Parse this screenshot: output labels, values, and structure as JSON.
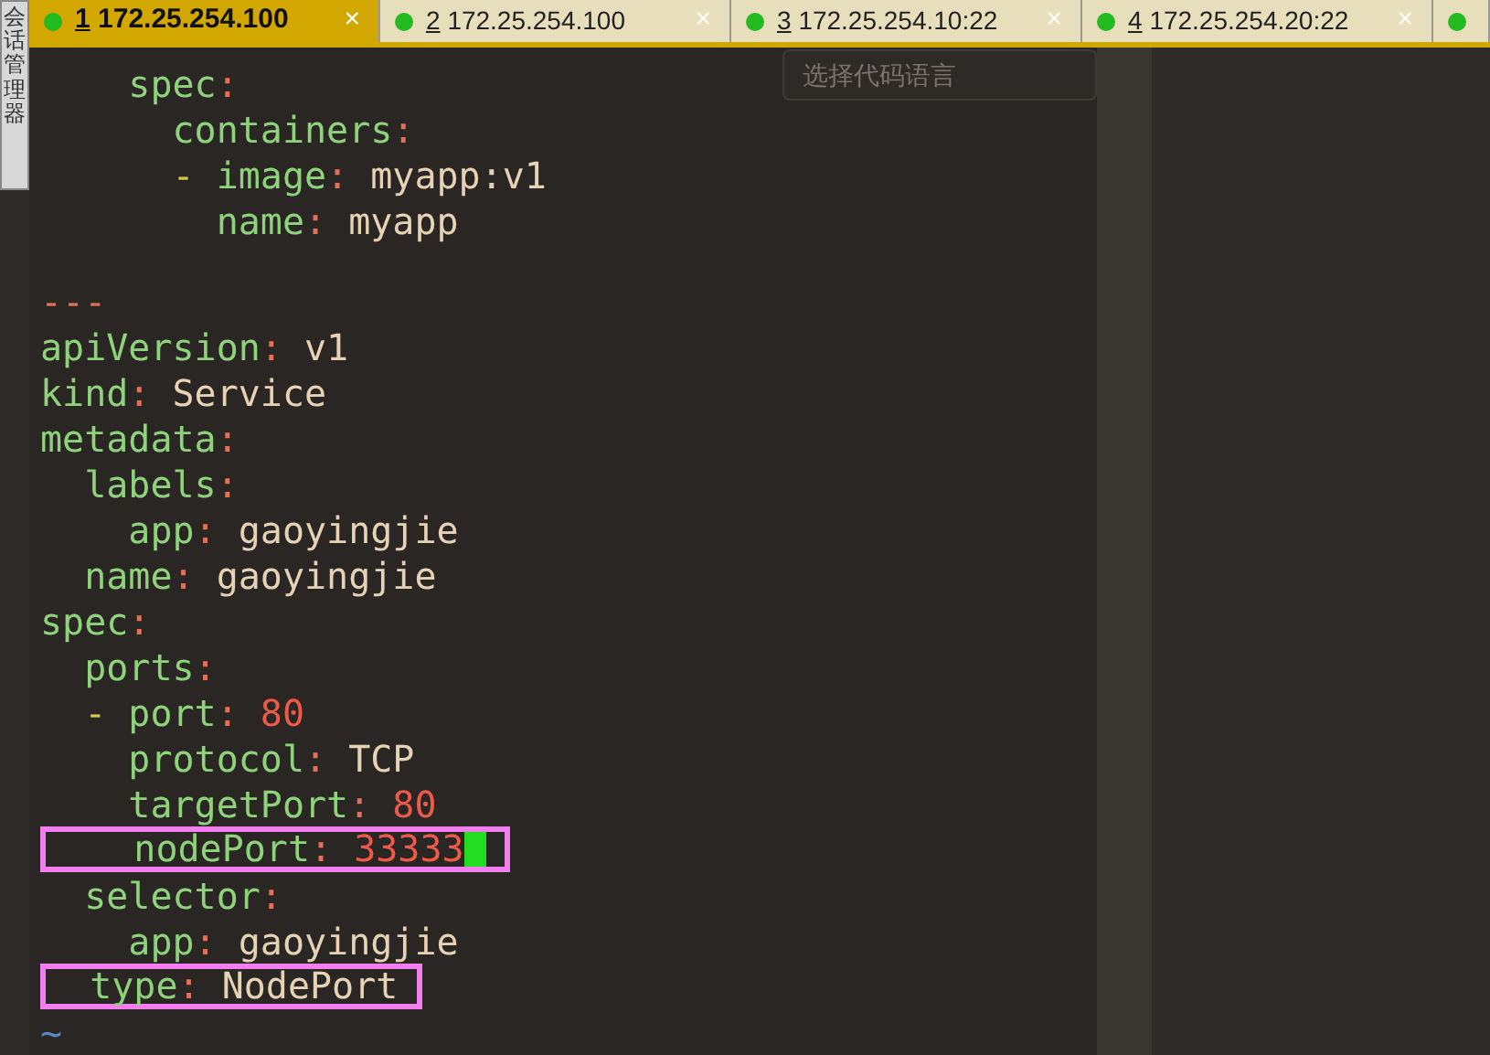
{
  "sidebar": {
    "label": "会话管理器"
  },
  "tabs": [
    {
      "number": "1",
      "title": "172.25.254.100",
      "close": "×",
      "selected": true,
      "color": "#22bb22"
    },
    {
      "number": "2",
      "title": "172.25.254.100",
      "close": "×",
      "selected": false,
      "color": "#22bb22"
    },
    {
      "number": "3",
      "title": "172.25.254.10:22",
      "close": "×",
      "selected": false,
      "color": "#22bb22"
    },
    {
      "number": "4",
      "title": "172.25.254.20:22",
      "close": "×",
      "selected": false,
      "color": "#22bb22"
    },
    {
      "selected": false,
      "color": "#22bb22"
    }
  ],
  "language_selector": {
    "placeholder": "选择代码语言"
  },
  "editor": {
    "lines": [
      {
        "kind": "code",
        "tokens": [
          {
            "t": "    spec",
            "kind": "key"
          },
          {
            "t": ":",
            "kind": "punct"
          }
        ]
      },
      {
        "kind": "code",
        "tokens": [
          {
            "t": "      containers",
            "kind": "key"
          },
          {
            "t": ":",
            "kind": "punct"
          }
        ]
      },
      {
        "kind": "code",
        "tokens": [
          {
            "t": "      -",
            "kind": "dash"
          },
          {
            "t": " image",
            "kind": "key"
          },
          {
            "t": ":",
            "kind": "punct"
          },
          {
            "t": " myapp:v1",
            "kind": "value"
          }
        ]
      },
      {
        "kind": "code",
        "tokens": [
          {
            "t": "        name",
            "kind": "key"
          },
          {
            "t": ":",
            "kind": "punct"
          },
          {
            "t": " myapp",
            "kind": "value"
          }
        ]
      },
      {
        "kind": "blank"
      },
      {
        "kind": "code",
        "tokens": [
          {
            "t": "---",
            "kind": "separator"
          }
        ]
      },
      {
        "kind": "code",
        "tokens": [
          {
            "t": "apiVersion",
            "kind": "key"
          },
          {
            "t": ":",
            "kind": "punct"
          },
          {
            "t": " v1",
            "kind": "value"
          }
        ]
      },
      {
        "kind": "code",
        "tokens": [
          {
            "t": "kind",
            "kind": "key"
          },
          {
            "t": ":",
            "kind": "punct"
          },
          {
            "t": " Service",
            "kind": "value"
          }
        ]
      },
      {
        "kind": "code",
        "tokens": [
          {
            "t": "metadata",
            "kind": "key"
          },
          {
            "t": ":",
            "kind": "punct"
          }
        ]
      },
      {
        "kind": "code",
        "tokens": [
          {
            "t": "  labels",
            "kind": "key"
          },
          {
            "t": ":",
            "kind": "punct"
          }
        ]
      },
      {
        "kind": "code",
        "tokens": [
          {
            "t": "    app",
            "kind": "key"
          },
          {
            "t": ":",
            "kind": "punct"
          },
          {
            "t": " gaoyingjie",
            "kind": "value"
          }
        ]
      },
      {
        "kind": "code",
        "tokens": [
          {
            "t": "  name",
            "kind": "key"
          },
          {
            "t": ":",
            "kind": "punct"
          },
          {
            "t": " gaoyingjie",
            "kind": "value"
          }
        ]
      },
      {
        "kind": "code",
        "tokens": [
          {
            "t": "spec",
            "kind": "key"
          },
          {
            "t": ":",
            "kind": "punct"
          }
        ]
      },
      {
        "kind": "code",
        "tokens": [
          {
            "t": "  ports",
            "kind": "key"
          },
          {
            "t": ":",
            "kind": "punct"
          }
        ]
      },
      {
        "kind": "code",
        "tokens": [
          {
            "t": "  -",
            "kind": "dash"
          },
          {
            "t": " port",
            "kind": "key"
          },
          {
            "t": ":",
            "kind": "punct"
          },
          {
            "t": " 80",
            "kind": "number"
          }
        ]
      },
      {
        "kind": "code",
        "tokens": [
          {
            "t": "    protocol",
            "kind": "key"
          },
          {
            "t": ":",
            "kind": "punct"
          },
          {
            "t": " TCP",
            "kind": "value"
          }
        ]
      },
      {
        "kind": "code",
        "tokens": [
          {
            "t": "    targetPort",
            "kind": "key"
          },
          {
            "t": ":",
            "kind": "punct"
          },
          {
            "t": " 80",
            "kind": "number"
          }
        ]
      },
      {
        "kind": "code",
        "highlighted": true,
        "cursor": true,
        "tokens": [
          {
            "t": "    nodePort",
            "kind": "key"
          },
          {
            "t": ":",
            "kind": "punct"
          },
          {
            "t": " 33333",
            "kind": "number"
          }
        ]
      },
      {
        "kind": "code",
        "tokens": [
          {
            "t": "  selector",
            "kind": "key"
          },
          {
            "t": ":",
            "kind": "punct"
          }
        ]
      },
      {
        "kind": "code",
        "tokens": [
          {
            "t": "    app",
            "kind": "key"
          },
          {
            "t": ":",
            "kind": "punct"
          },
          {
            "t": " gaoyingjie",
            "kind": "value"
          }
        ]
      },
      {
        "kind": "code",
        "highlighted": true,
        "tokens": [
          {
            "t": "  type",
            "kind": "key"
          },
          {
            "t": ":",
            "kind": "punct"
          },
          {
            "t": " NodePort",
            "kind": "value"
          }
        ]
      },
      {
        "kind": "code",
        "tokens": [
          {
            "t": "~",
            "kind": "tilde"
          }
        ]
      }
    ]
  }
}
